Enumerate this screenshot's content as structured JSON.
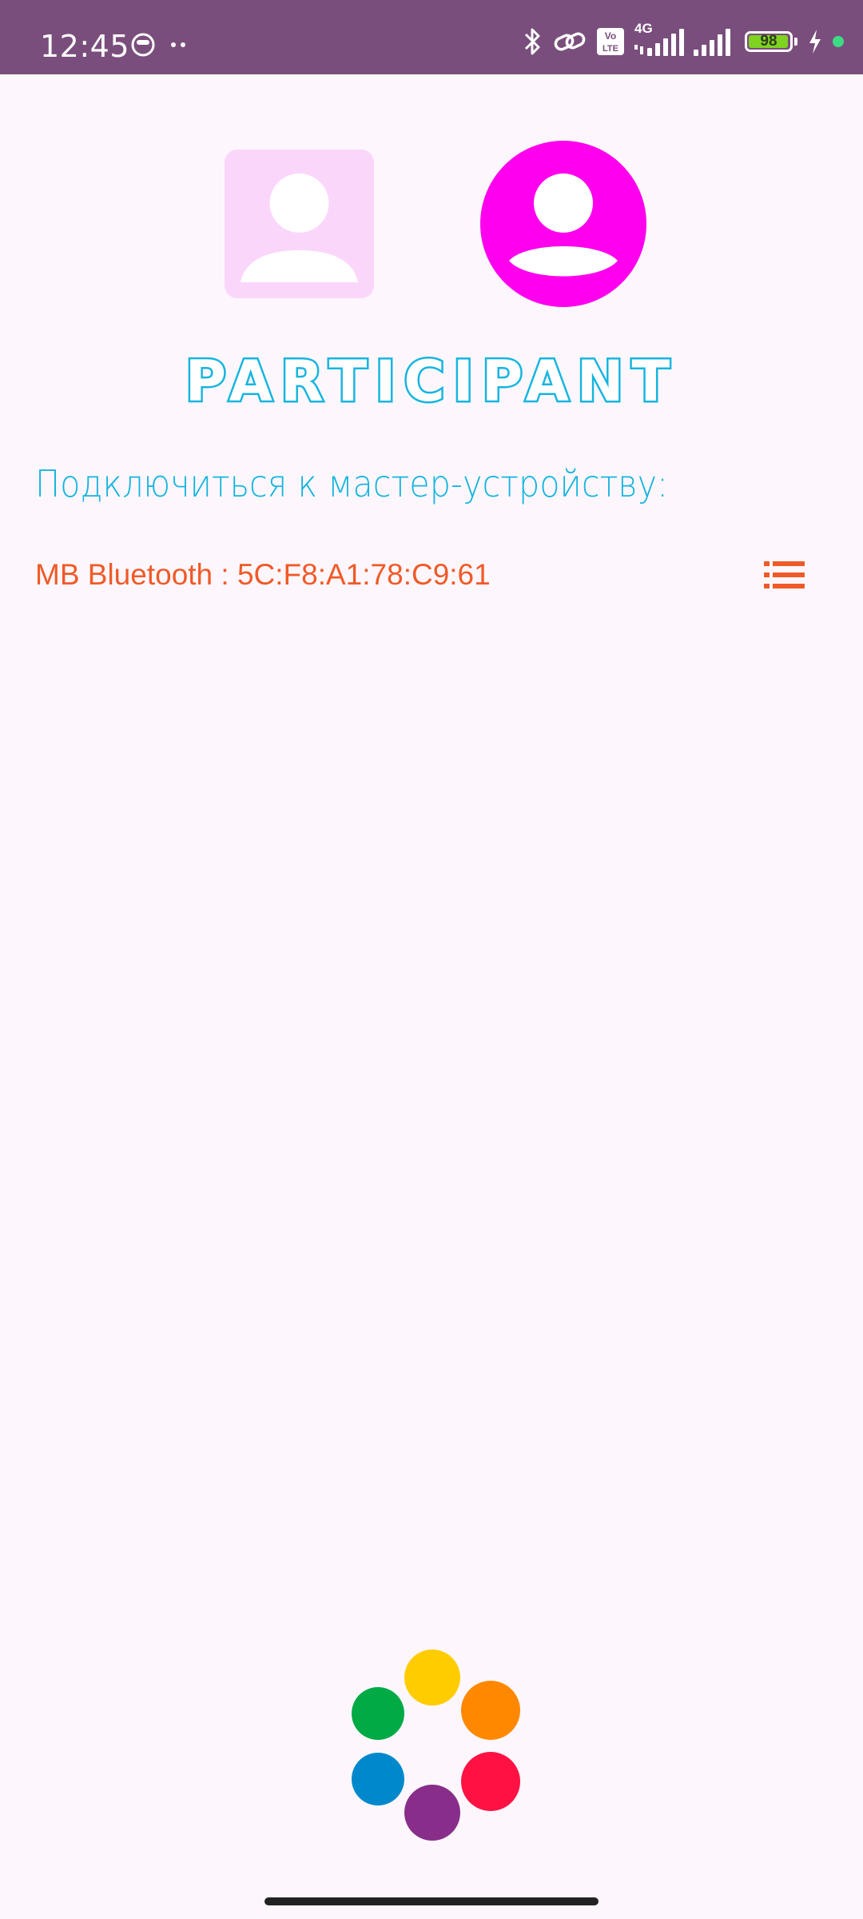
{
  "status_bar": {
    "time": "12:45",
    "battery_level": "98",
    "battery_fraction": 0.98,
    "network_type": "4G",
    "volte_line1": "Vo",
    "volte_line2": "LTE",
    "icons": [
      "face-icon",
      "dots-icon",
      "bluetooth-icon",
      "link-icon",
      "volte-icon",
      "signal-icon",
      "signal-icon",
      "battery-icon",
      "charging-icon",
      "green-dot"
    ]
  },
  "avatars": {
    "left": {
      "icon": "person-icon",
      "color": "#fbd6fb"
    },
    "right": {
      "icon": "person-icon",
      "color": "#ff00ee"
    }
  },
  "title": "PARTICIPANT",
  "subtitle": "Подключиться к мастер-устройству:",
  "device": {
    "label": "MB Bluetooth : 5C:F8:A1:78:C9:61",
    "icon": "list-icon",
    "color": "#f05a28"
  },
  "loader": {
    "icon": "loading-dots-icon",
    "colors": [
      "#ffcc00",
      "#ff8800",
      "#ff1144",
      "#882e8a",
      "#0088cc",
      "#00aa44"
    ]
  },
  "theme": {
    "status_bar": "#7a4e7c",
    "background": "#fdf7fd",
    "title_stroke": "#16b5df"
  }
}
